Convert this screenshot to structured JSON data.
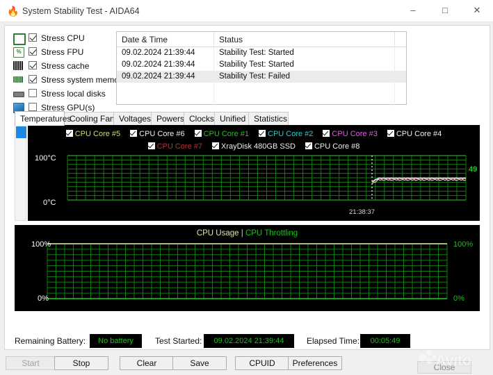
{
  "window": {
    "title": "System Stability Test - AIDA64",
    "icon": "flame-icon",
    "minimize_label": "–",
    "maximize_label": "□",
    "close_label": "✕"
  },
  "stress_options": [
    {
      "label": "Stress CPU",
      "checked": true,
      "icon": "cpu-chip-icon"
    },
    {
      "label": "Stress FPU",
      "checked": true,
      "icon": "fpu-percent-icon"
    },
    {
      "label": "Stress cache",
      "checked": true,
      "icon": "cache-icon"
    },
    {
      "label": "Stress system memory",
      "checked": true,
      "icon": "memory-module-icon"
    },
    {
      "label": "Stress local disks",
      "checked": false,
      "icon": "hard-disk-icon"
    },
    {
      "label": "Stress GPU(s)",
      "checked": false,
      "icon": "gpu-card-icon"
    }
  ],
  "log": {
    "columns": [
      "Date & Time",
      "Status",
      ""
    ],
    "rows": [
      {
        "datetime": "09.02.2024 21:39:44",
        "status": "Stability Test: Started",
        "extra": ""
      },
      {
        "datetime": "09.02.2024 21:39:44",
        "status": "Stability Test: Started",
        "extra": ""
      },
      {
        "datetime": "09.02.2024 21:39:44",
        "status": "Stability Test: Failed",
        "extra": ""
      }
    ]
  },
  "tabs": [
    {
      "label": "Temperatures",
      "active": true
    },
    {
      "label": "Cooling Fans",
      "active": false
    },
    {
      "label": "Voltages",
      "active": false
    },
    {
      "label": "Powers",
      "active": false
    },
    {
      "label": "Clocks",
      "active": false
    },
    {
      "label": "Unified",
      "active": false
    },
    {
      "label": "Statistics",
      "active": false
    }
  ],
  "temperature_legend_row1": [
    {
      "label": "CPU Core #5",
      "color": "#d9d96a",
      "checked": true
    },
    {
      "label": "CPU Core #6",
      "color": "#f0f0f0",
      "checked": true
    },
    {
      "label": "CPU Core #1",
      "color": "#22c322",
      "checked": true
    },
    {
      "label": "CPU Core #2",
      "color": "#2ecccc",
      "checked": true
    },
    {
      "label": "CPU Core #3",
      "color": "#e05ae0",
      "checked": true
    },
    {
      "label": "CPU Core #4",
      "color": "#f0f0f0",
      "checked": true
    }
  ],
  "temperature_legend_row2": [
    {
      "label": "CPU Core #7",
      "color": "#c03030",
      "checked": true
    },
    {
      "label": "XrayDisk 480GB SSD",
      "color": "#f0f0f0",
      "checked": true
    },
    {
      "label": "CPU Core #8",
      "color": "#f0f0f0",
      "checked": true
    }
  ],
  "chart_data": [
    {
      "type": "line",
      "name": "temperatures",
      "title": "",
      "ylabel": "",
      "ylim": [
        0,
        100
      ],
      "y_axis_top_label": "100°C",
      "y_axis_bottom_label": "0°C",
      "grid": true,
      "grid_color": "#127d12",
      "background": "#000000",
      "time_marker_label": "21:38:37",
      "current_value_labels": [
        {
          "text": "49",
          "color": "#22c322"
        },
        {
          "text": "49",
          "color": "#f0f0f0"
        },
        {
          "text": "49",
          "color": "#c03030"
        }
      ],
      "series": [
        {
          "name": "CPU Core #5",
          "color": "#d9d96a",
          "current": 49
        },
        {
          "name": "CPU Core #6",
          "color": "#f0f0f0",
          "current": 49
        },
        {
          "name": "CPU Core #1",
          "color": "#22c322",
          "current": 49
        },
        {
          "name": "CPU Core #2",
          "color": "#2ecccc",
          "current": 49
        },
        {
          "name": "CPU Core #3",
          "color": "#e05ae0",
          "current": 49
        },
        {
          "name": "CPU Core #4",
          "color": "#f0f0f0",
          "current": 49
        },
        {
          "name": "CPU Core #7",
          "color": "#c03030",
          "current": 47
        },
        {
          "name": "XrayDisk 480GB SSD",
          "color": "#f0f0f0",
          "current": 45
        },
        {
          "name": "CPU Core #8",
          "color": "#f0f0f0",
          "current": 49
        }
      ],
      "note": "All series flat near 49°C in the right-hand third of the plot; left two-thirds empty (no data yet)."
    },
    {
      "type": "line",
      "name": "cpu_usage",
      "title_part1": "CPU Usage",
      "title_separator": "|",
      "title_part2": "CPU Throttling",
      "ylim": [
        0,
        100
      ],
      "y_axis_top_label": "100%",
      "y_axis_bottom_label": "0%",
      "y_axis_top_label_right": "100%",
      "y_axis_bottom_label_right": "0%",
      "grid": true,
      "grid_color": "#127d12",
      "background": "#000000",
      "series": [
        {
          "name": "CPU Usage",
          "color": "#e4e4a8",
          "values": [
            100,
            100
          ],
          "current": 100
        },
        {
          "name": "CPU Throttling",
          "color": "#19c119",
          "values": [
            0,
            0
          ],
          "current": 0
        }
      ]
    }
  ],
  "status": {
    "battery_label": "Remaining Battery:",
    "battery_value": "No battery",
    "started_label": "Test Started:",
    "started_value": "09.02.2024 21:39:44",
    "elapsed_label": "Elapsed Time:",
    "elapsed_value": "00:05:49"
  },
  "buttons": [
    {
      "label": "Start",
      "disabled": true
    },
    {
      "label": "Stop",
      "disabled": false
    },
    {
      "label": "Clear",
      "disabled": false
    },
    {
      "label": "Save",
      "disabled": false
    },
    {
      "label": "CPUID",
      "disabled": false
    },
    {
      "label": "Preferences",
      "disabled": false
    },
    {
      "label": "Close",
      "disabled": false
    }
  ],
  "watermark": {
    "text": "Avito"
  }
}
